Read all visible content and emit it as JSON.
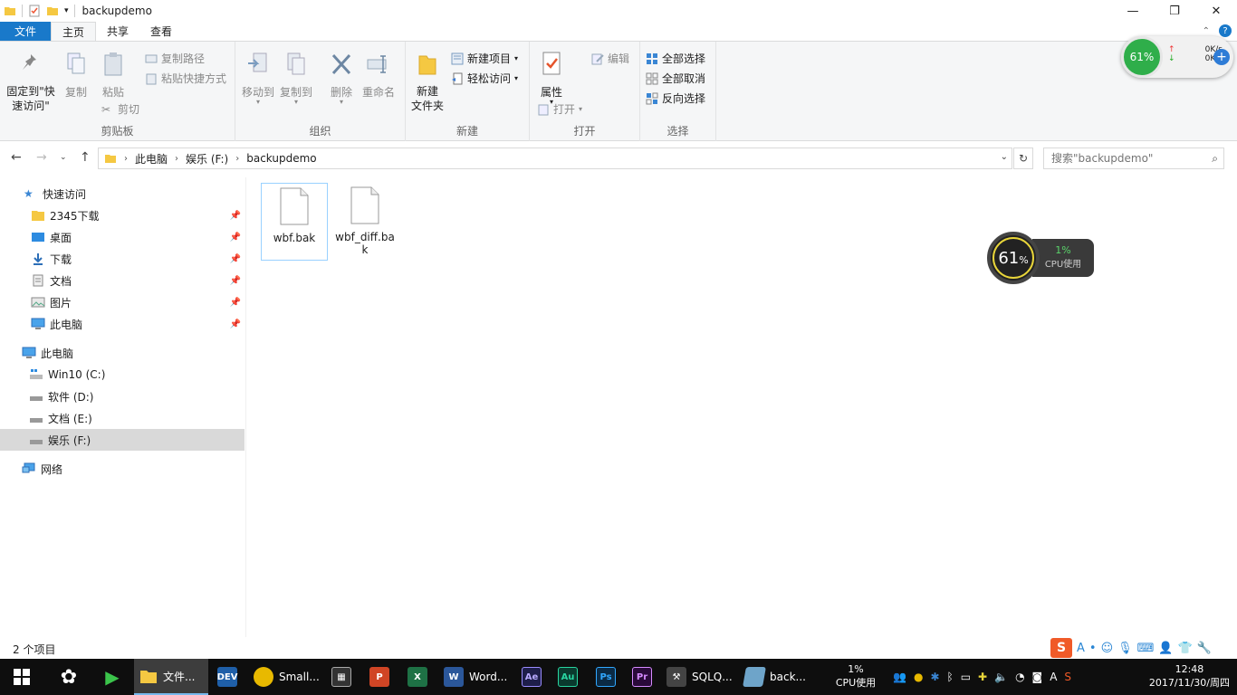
{
  "window": {
    "title": "backupdemo",
    "minimize": "—",
    "maximize": "❐",
    "close": "✕"
  },
  "tabs": [
    "文件",
    "主页",
    "共享",
    "查看"
  ],
  "ribbon": {
    "clipboard": {
      "label": "剪贴板",
      "pin_quick": "固定到\"快速访问\"",
      "copy": "复制",
      "paste": "粘贴",
      "copy_path": "复制路径",
      "paste_shortcut": "粘贴快捷方式",
      "cut": "剪切"
    },
    "organize": {
      "label": "组织",
      "move_to": "移动到",
      "copy_to": "复制到",
      "delete": "删除",
      "rename": "重命名"
    },
    "new": {
      "label": "新建",
      "new_folder": "新建\n文件夹",
      "new_item": "新建项目",
      "easy_access": "轻松访问"
    },
    "open": {
      "label": "打开",
      "properties": "属性",
      "open": "打开",
      "edit": "编辑"
    },
    "select": {
      "label": "选择",
      "select_all": "全部选择",
      "select_none": "全部取消",
      "invert": "反向选择"
    }
  },
  "address": {
    "crumbs": [
      "此电脑",
      "娱乐 (F:)",
      "backupdemo"
    ],
    "search_placeholder": "搜索\"backupdemo\""
  },
  "nav": {
    "quick_access": "快速访问",
    "pinned": [
      "2345下载",
      "桌面",
      "下载",
      "文档",
      "图片",
      "此电脑"
    ],
    "this_pc": "此电脑",
    "drives": [
      "Win10 (C:)",
      "软件 (D:)",
      "文档 (E:)",
      "娱乐 (F:)"
    ],
    "network": "网络"
  },
  "files": [
    {
      "name": "wbf.bak"
    },
    {
      "name": "wbf_diff.bak"
    }
  ],
  "status": "2 个项目",
  "widget_net": {
    "percent": "61%",
    "up": "0K/s",
    "down": "0K/s"
  },
  "widget_cpu": {
    "percent": "61",
    "pct_sign": "%",
    "cpu": "1%",
    "cpu_label": "CPU使用"
  },
  "taskbar": {
    "items": [
      {
        "label": "文件...",
        "icon": "folder-icon",
        "color": "#f2c94c"
      },
      {
        "label": "",
        "icon": "DEV",
        "color": "#1f5fa8"
      },
      {
        "label": "Small...",
        "icon": "small-icon",
        "color": "#e8b900"
      },
      {
        "label": "",
        "icon": "film",
        "color": "#333"
      },
      {
        "label": "",
        "icon": "P",
        "color": "#d04525"
      },
      {
        "label": "",
        "icon": "X",
        "color": "#1e7145"
      },
      {
        "label": "Word...",
        "icon": "W",
        "color": "#2b579a"
      },
      {
        "label": "",
        "icon": "Ae",
        "color": "#1e1e4a"
      },
      {
        "label": "",
        "icon": "Au",
        "color": "#0a3a2e"
      },
      {
        "label": "",
        "icon": "Ps",
        "color": "#0b2a44"
      },
      {
        "label": "",
        "icon": "Pr",
        "color": "#2a0a3a"
      },
      {
        "label": "SQLQ...",
        "icon": "tools",
        "color": "#444"
      },
      {
        "label": "back...",
        "icon": "doc",
        "color": "#6ea4c9"
      }
    ],
    "cpu": "1%",
    "cpu_label": "CPU使用",
    "time": "12:48",
    "date": "2017/11/30/周四"
  }
}
